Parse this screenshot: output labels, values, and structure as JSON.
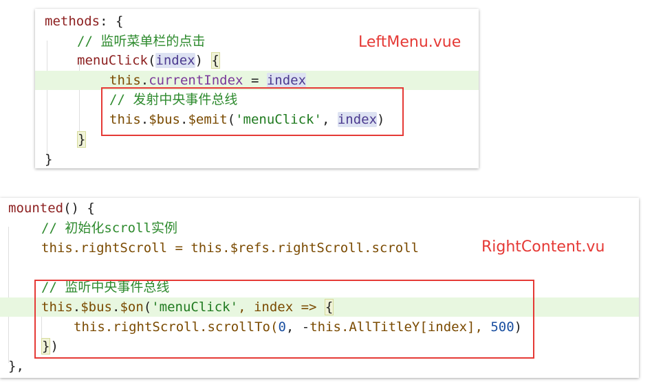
{
  "snippet1": {
    "file_label": "LeftMenu.vue",
    "lines": {
      "l1": [
        "methods",
        ": {"
      ],
      "l2": "// 监听菜单栏的点击",
      "l3": [
        "menuClick",
        "(",
        "index",
        ") ",
        "{"
      ],
      "l4": [
        "this",
        ".",
        "currentIndex",
        " = ",
        "index"
      ],
      "l5": "// 发射中央事件总线",
      "l6": [
        "this",
        ".",
        "$bus",
        ".",
        "$emit",
        "(",
        "'menuClick'",
        ", ",
        "index",
        ")"
      ],
      "l7": "}",
      "l8": "}"
    }
  },
  "snippet2": {
    "file_label": "RightContent.vu",
    "lines": {
      "l1": [
        "mounted",
        "() {"
      ],
      "l2": "// 初始化scroll实例",
      "l3": [
        "this",
        ".rightScroll = ",
        "this",
        ".$refs.rightScroll.scroll"
      ],
      "l5": "// 监听中央事件总线",
      "l6": [
        "this",
        ".",
        "$bus",
        ".",
        "$on",
        "(",
        "'menuClick'",
        ", index => ",
        "{"
      ],
      "l7": [
        "this",
        ".rightScroll.scrollTo(",
        "0",
        ", -",
        "this",
        ".AllTitleY[index], ",
        "500",
        ")"
      ],
      "l8": [
        "}",
        ")"
      ],
      "l9": "},"
    }
  },
  "colors": {
    "highlight_line": "#e8f7e0",
    "annotation_red": "#e53935",
    "comment_green": "#2d8a2d"
  }
}
